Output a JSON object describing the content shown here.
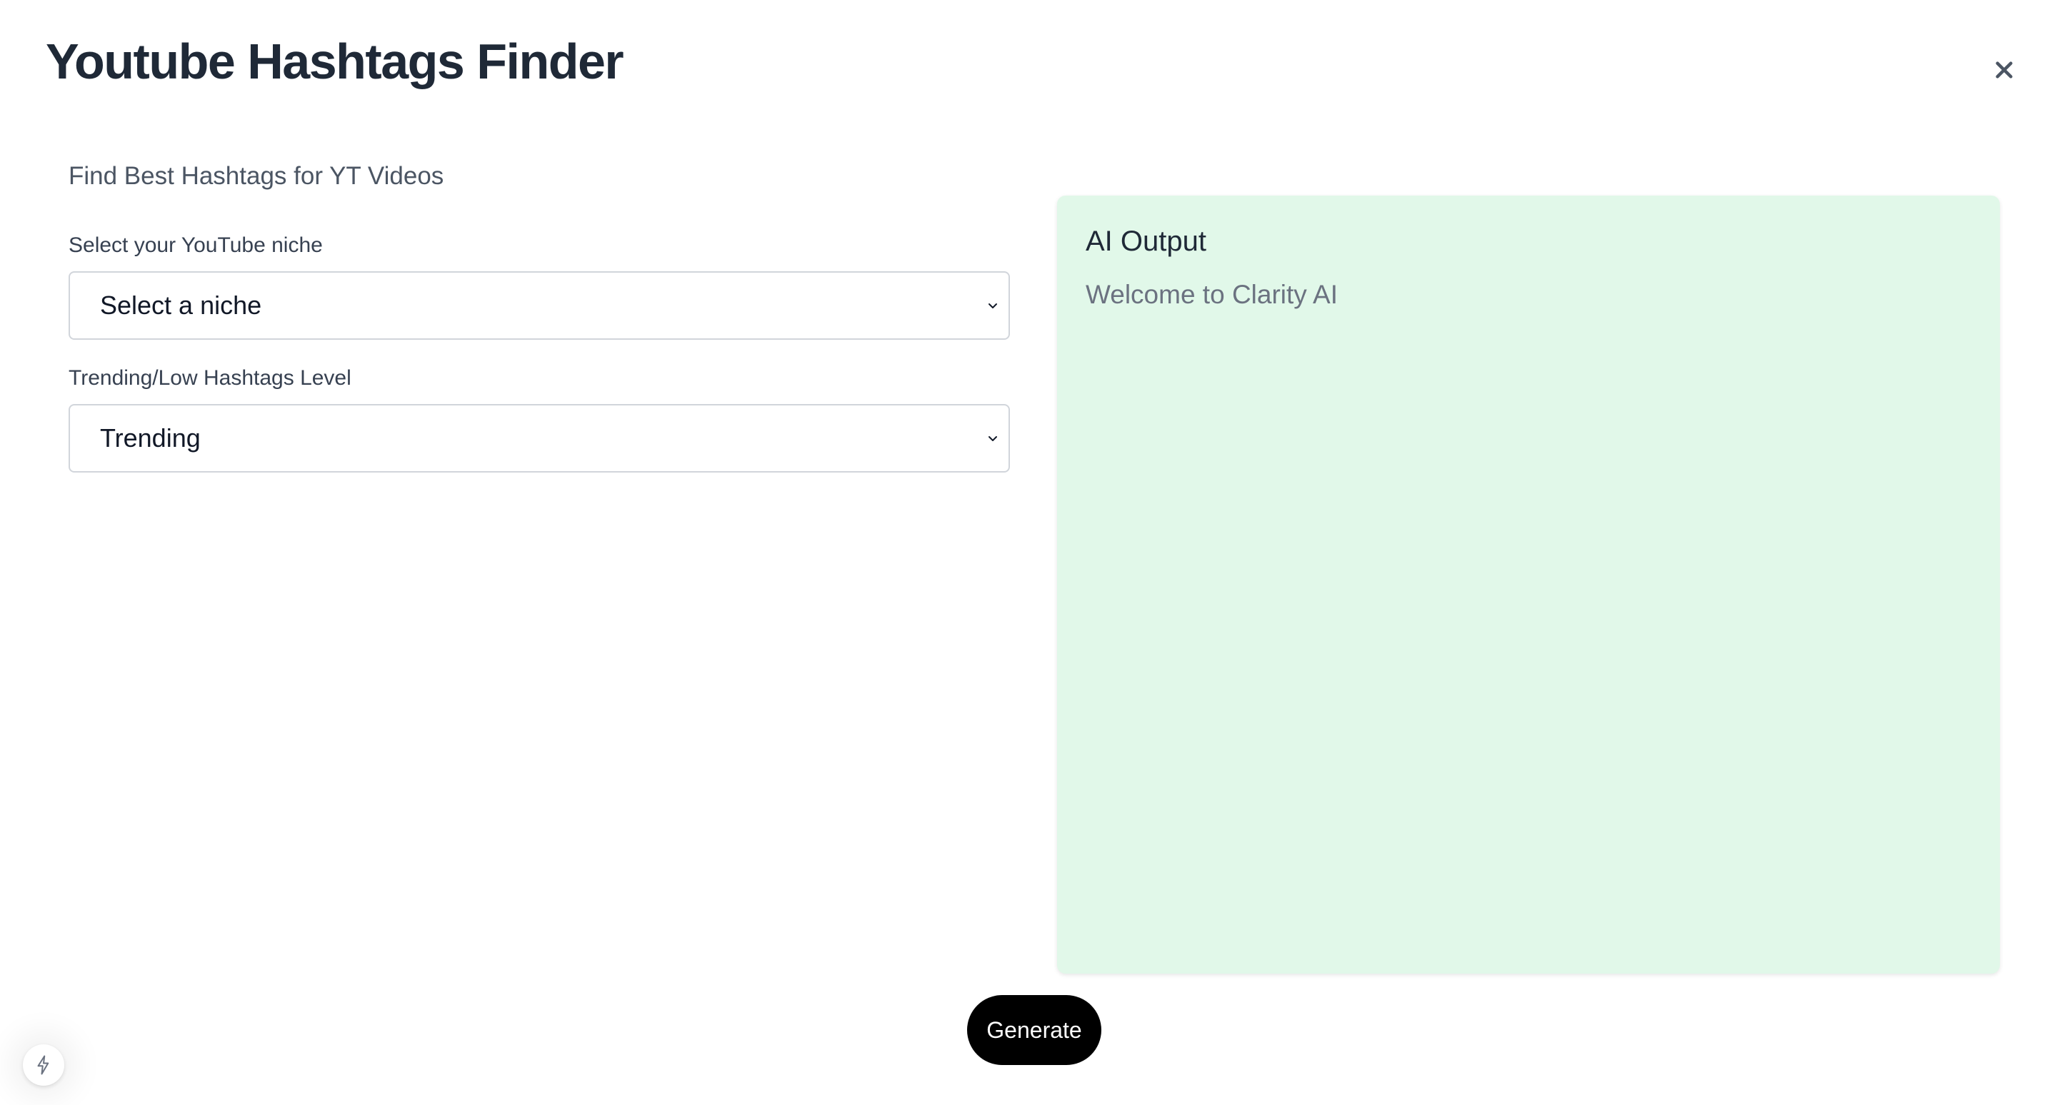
{
  "header": {
    "title": "Youtube Hashtags Finder",
    "close_icon": "close-icon"
  },
  "form": {
    "subtitle": "Find Best Hashtags for YT Videos",
    "niche": {
      "label": "Select your YouTube niche",
      "value": "Select a niche"
    },
    "level": {
      "label": "Trending/Low Hashtags Level",
      "value": "Trending"
    }
  },
  "output": {
    "title": "AI Output",
    "text": "Welcome to Clarity AI",
    "background_color": "#e1f8e9"
  },
  "actions": {
    "generate_label": "Generate"
  },
  "floating": {
    "icon": "lightning-bolt-icon"
  }
}
